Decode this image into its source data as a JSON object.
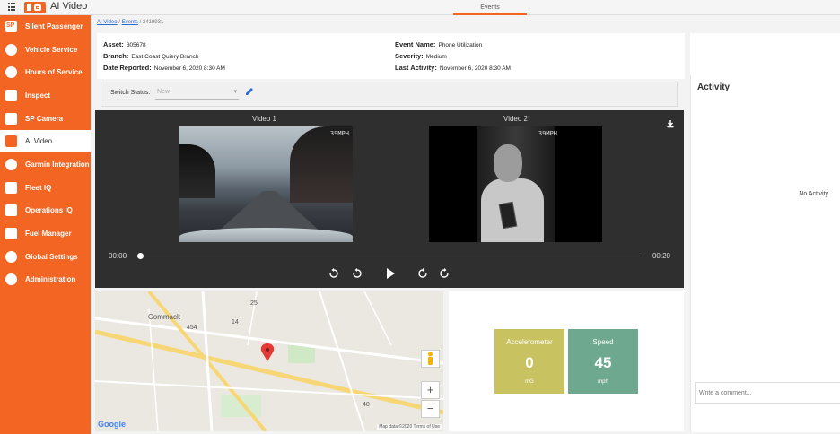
{
  "app": {
    "title": "AI Video",
    "active_tab": "Events"
  },
  "sidebar": {
    "items": [
      {
        "label": "Silent Passenger",
        "icon": "silent-passenger-icon"
      },
      {
        "label": "Vehicle Service",
        "icon": "vehicle-service-icon"
      },
      {
        "label": "Hours of Service",
        "icon": "hours-of-service-icon"
      },
      {
        "label": "Inspect",
        "icon": "inspect-icon"
      },
      {
        "label": "SP Camera",
        "icon": "sp-camera-icon"
      },
      {
        "label": "AI Video",
        "icon": "ai-video-icon",
        "active": true
      },
      {
        "label": "Garmin Integration",
        "icon": "garmin-icon"
      },
      {
        "label": "Fleet IQ",
        "icon": "fleet-iq-icon"
      },
      {
        "label": "Operations IQ",
        "icon": "operations-iq-icon"
      },
      {
        "label": "Fuel Manager",
        "icon": "fuel-manager-icon"
      },
      {
        "label": "Global Settings",
        "icon": "gear-icon"
      },
      {
        "label": "Administration",
        "icon": "administration-icon"
      }
    ]
  },
  "breadcrumb": {
    "root": "AI Video",
    "events": "Events",
    "current": "2419931",
    "sep": "/"
  },
  "details": {
    "asset_label": "Asset:",
    "asset_value": "305678",
    "branch_label": "Branch:",
    "branch_value": "East Coast Quiery Branch",
    "reported_label": "Date Reported:",
    "reported_value": "November 6, 2020 8:30 AM",
    "event_label": "Event Name:",
    "event_value": "Phone Utilization",
    "severity_label": "Severity:",
    "severity_value": "Medium",
    "last_label": "Last Activity:",
    "last_value": "November 6, 2020 8:30 AM"
  },
  "switch_status": {
    "label": "Switch Status:",
    "value": "New"
  },
  "video": {
    "video1_title": "Video 1",
    "video2_title": "Video 2",
    "speed_overlay": "39MPH",
    "time_start": "00:00",
    "time_end": "00:20",
    "progress": 0
  },
  "map": {
    "labels": {
      "commack": "Commack",
      "r454": "454",
      "r14": "14",
      "r25": "25",
      "r40": "40"
    },
    "attribution": "Map data ©2020  Terms of Use",
    "google": "Google",
    "zoom_in": "+",
    "zoom_out": "−"
  },
  "metrics": {
    "accelerometer": {
      "name": "Accelerometer",
      "value": "0",
      "unit": "mG",
      "color": "#c9c261"
    },
    "speed": {
      "name": "Speed",
      "value": "45",
      "unit": "mph",
      "color": "#6ea88f"
    }
  },
  "activity": {
    "title": "Activity",
    "empty": "No Activity",
    "comment_placeholder": "Write a comment..."
  },
  "colors": {
    "brand": "#f26522",
    "player_bg": "#2f2f2f",
    "link": "#2a6bd6"
  }
}
